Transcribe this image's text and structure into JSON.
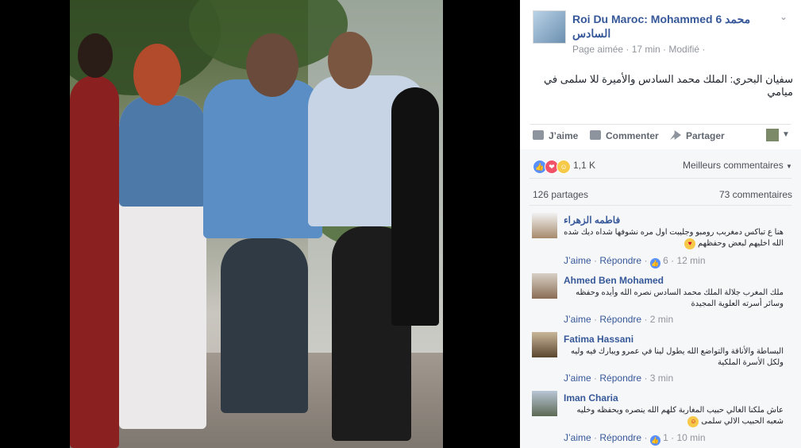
{
  "post": {
    "page_name": "Roi Du Maroc: Mohammed 6 محمد السادس",
    "meta": "Page aimée · 17 min · Modifié ·",
    "caption": "سفيان البحري: الملك محمد السادس والأميرة للا سلمى في ميامي"
  },
  "actions": {
    "like": "J’aime",
    "comment": "Commenter",
    "share": "Partager"
  },
  "reactions": {
    "count": "1,1 K",
    "sort": "Meilleurs commentaires",
    "shares": "126 partages",
    "comments": "73 commentaires"
  },
  "comments": [
    {
      "name": "فاطمه الزهراء",
      "text": "هنا ع تباكس دمغربب رومبو وجليبت اول مره نشوفها شداه ديك شده الله اخليهم لبعض وحفظهم",
      "like": "J’aime",
      "reply": "Répondre",
      "likes": "6",
      "time": "12 min"
    },
    {
      "name": "Ahmed Ben Mohamed",
      "text": "ملك المغرب جلالة الملك محمد السادس نصره الله وأيده وحفظه وسائر أسرته العلوية المجيدة",
      "like": "J’aime",
      "reply": "Répondre",
      "time": "2 min"
    },
    {
      "name": "Fatima Hassani",
      "text": "البساطة والأناقة والتواضع الله يطول لينا في عمرو ويبارك فيه وليه ولكل الأسرة الملكية",
      "like": "J’aime",
      "reply": "Répondre",
      "time": "3 min"
    },
    {
      "name": "Iman Charia",
      "text": "عاش ملكنا الغالي حبيب المغاربة كلهم الله ينصره ويحفظه وخليه شعبه الحبيب الالي سلمى",
      "like": "J’aime",
      "reply": "Répondre",
      "likes": "1",
      "time": "10 min"
    }
  ],
  "colors": {
    "link": "#365899",
    "muted": "#90949c",
    "like_blue": "#5890ff"
  }
}
